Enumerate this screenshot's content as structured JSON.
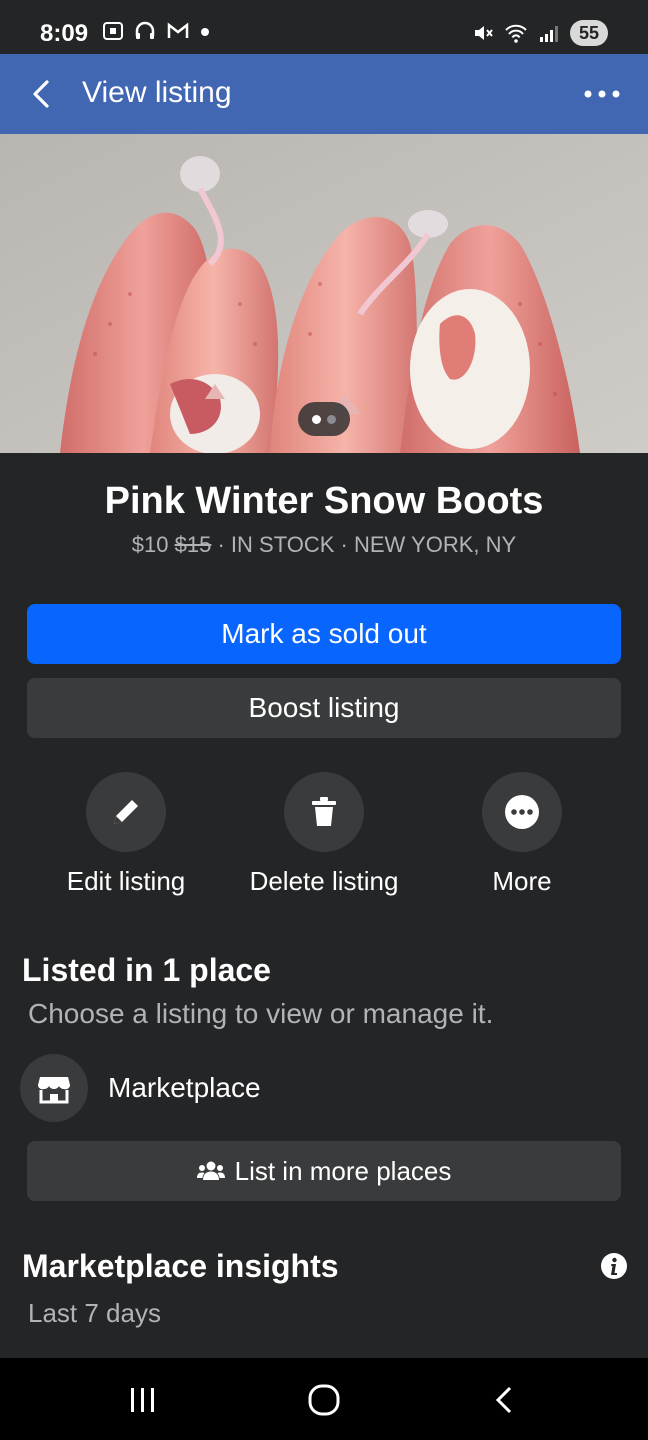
{
  "status_bar": {
    "time": "8:09",
    "battery": "55",
    "left_icons": [
      "screenshot-icon",
      "headphones-icon",
      "gmail-icon",
      "dot-icon"
    ],
    "right_icons": [
      "mute-icon",
      "wifi-icon",
      "signal-icon",
      "battery-icon"
    ]
  },
  "header": {
    "title": "View listing",
    "back_icon": "chevron-left-icon",
    "more_icon": "more-horizontal-icon"
  },
  "photo": {
    "description_icon": "listing-photo",
    "pager_count": 2,
    "pager_active": 0
  },
  "listing": {
    "title": "Pink Winter Snow Boots",
    "price": "$10",
    "original_price": "$15",
    "separator1": " · ",
    "stock": "IN STOCK",
    "separator2": " · ",
    "location": "NEW YORK, NY"
  },
  "buttons": {
    "primary": "Mark as sold out",
    "secondary": "Boost listing"
  },
  "actions": [
    {
      "label": "Edit listing",
      "icon": "pencil-icon"
    },
    {
      "label": "Delete listing",
      "icon": "trash-icon"
    },
    {
      "label": "More",
      "icon": "more-circle-icon"
    }
  ],
  "places": {
    "title": "Listed in 1 place",
    "subtitle": "Choose a listing to view or manage it.",
    "items": [
      {
        "label": "Marketplace",
        "icon": "marketplace-store-icon"
      }
    ],
    "more_button": "List in more places"
  },
  "insights": {
    "title": "Marketplace insights",
    "subtitle": "Last 7 days",
    "info_icon": "info-icon"
  },
  "colors": {
    "background": "#242526",
    "app_bar": "#4267b2",
    "primary_button": "#0866ff",
    "secondary_button": "#3a3b3c",
    "muted_text": "#b0b3b8"
  },
  "nav": {
    "recents_icon": "recents-icon",
    "home_icon": "home-icon",
    "back_icon": "back-icon"
  }
}
